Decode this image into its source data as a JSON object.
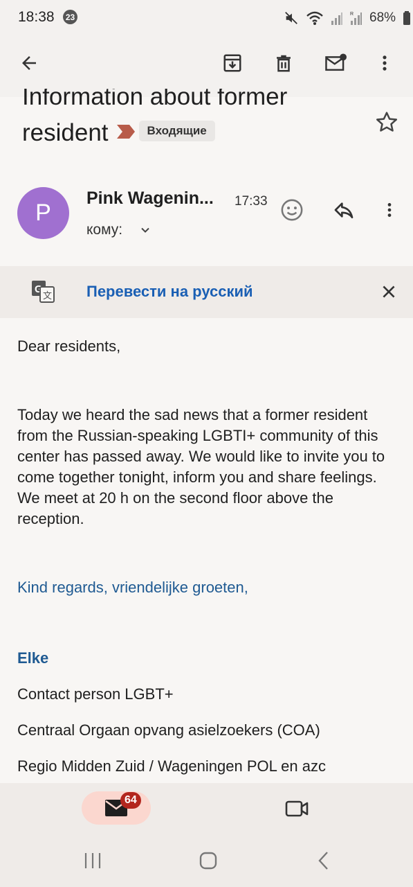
{
  "status_bar": {
    "time": "18:38",
    "notification_count": "23",
    "battery": "68%",
    "icons": [
      "mute-icon",
      "wifi-icon",
      "signal-icon",
      "signal-roaming-icon",
      "battery-icon"
    ]
  },
  "toolbar": {
    "icons": [
      "back-arrow-icon",
      "archive-icon",
      "delete-icon",
      "mark-unread-icon",
      "more-vert-icon"
    ]
  },
  "email": {
    "subject_line1": "Information about former",
    "subject_line2": "resident",
    "label": "Входящие",
    "sender_initial": "P",
    "sender_name": "Pink Wagenin...",
    "time": "17:33",
    "to_label": "кому:",
    "translate_text": "Перевести на русский",
    "greeting": "Dear residents,",
    "body": "Today we heard the sad news that a former resident from the Russian-speaking LGBTI+ community of this center has passed away. We would like to invite you to come together tonight, inform you and share feelings. We meet at 20 h on the second floor above the reception.",
    "regards": "Kind regards, vriendelijke groeten,",
    "signature": {
      "name": "Elke",
      "role": "Contact person LGBT+",
      "organization": "Centraal Orgaan opvang asielzoekers (COA)",
      "region": "Regio Midden Zuid / Wageningen POL en azc"
    }
  },
  "bottom_nav": {
    "mail_unread_count": "64",
    "tabs": [
      "mail-icon",
      "meet-video-icon"
    ]
  },
  "colors": {
    "avatar": "#a070d0",
    "link": "#1a5fb4",
    "signature": "#1f5a92",
    "badge": "#b3261e",
    "mail_tab_active": "#fbd7cf",
    "importance_marker": "#b85c4a"
  }
}
